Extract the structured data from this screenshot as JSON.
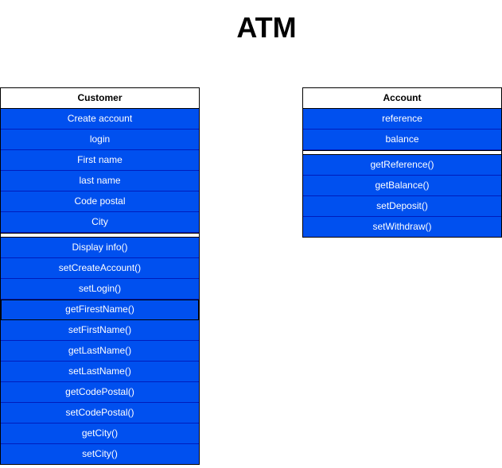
{
  "title": "ATM",
  "colors": {
    "row_fill": "#0050ef",
    "row_border": "#001dbc",
    "header_fill": "#ffffff",
    "text_light": "#ffffff",
    "text_dark": "#000000"
  },
  "customer": {
    "name": "Customer",
    "attributes": [
      "Create account",
      "login",
      "First name",
      "last name",
      "Code postal",
      "City"
    ],
    "methods": [
      "Display info()",
      "setCreateAccount()",
      "setLogin()",
      "getFirestName()",
      "setFirstName()",
      "getLastName()",
      "setLastName()",
      "getCodePostal()",
      "setCodePostal()",
      "getCity()",
      "setCity()"
    ]
  },
  "account": {
    "name": "Account",
    "attributes": [
      "reference",
      "balance"
    ],
    "methods": [
      "getReference()",
      "getBalance()",
      "setDeposit()",
      "setWithdraw()"
    ]
  }
}
